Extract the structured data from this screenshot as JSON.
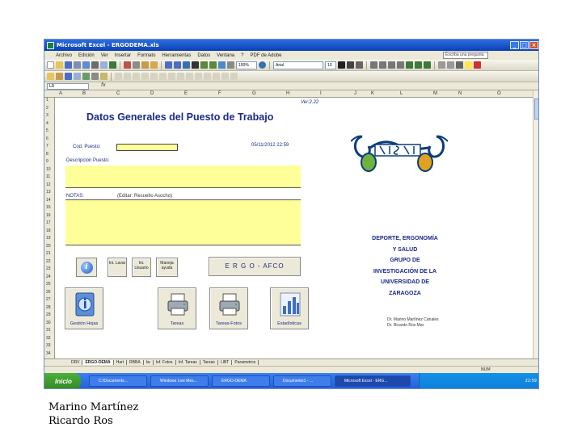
{
  "window": {
    "title": "Microsoft Excel - ERGODEMA.xls"
  },
  "menu": [
    "Archivo",
    "Edición",
    "Ver",
    "Insertar",
    "Formato",
    "Herramientas",
    "Datos",
    "Ventana",
    "?",
    "PDF de Adobe"
  ],
  "menu_help_placeholder": "Escriba una pregunta",
  "toolbar": {
    "zoom": "100%",
    "font": "Arial",
    "font_size": "10"
  },
  "formula_bar": {
    "name_box": "L9",
    "fx": "fx"
  },
  "columns": [
    "A",
    "B",
    "C",
    "D",
    "E",
    "F",
    "G",
    "H",
    "I",
    "J",
    "K",
    "L",
    "M",
    "N",
    "O"
  ],
  "rows": [
    "1",
    "2",
    "3",
    "4",
    "5",
    "6",
    "7",
    "8",
    "9",
    "10",
    "11",
    "12",
    "13",
    "14",
    "15",
    "16",
    "17",
    "18",
    "19",
    "20",
    "21",
    "22",
    "23",
    "24",
    "25",
    "26",
    "27",
    "28",
    "29",
    "30",
    "31",
    "32",
    "33",
    "34"
  ],
  "sheet": {
    "version": "Ver.2.22",
    "title": "Datos Generales del Puesto de Trabajo",
    "cod_label": "Cod. Puesto:",
    "date": "05/11/2012 22:59",
    "desc_label": "Descripcion Puesto:",
    "notes_label": "NOTAS:",
    "notes_text": "(Editar: Resuelto Asocho)",
    "buttons": {
      "btn1": "Ini. Lavar",
      "btn2": "Ini. Usuario",
      "btn3": "Maneja ayuda",
      "ergo": "E R G O - AFCO",
      "big1": "Gestión Hojas",
      "big2": "Tareas",
      "big3": "Tareas-Fotos",
      "big4": "Estadísticas"
    },
    "org_lines": [
      "DEPORTE, ERGONOMÍA",
      "Y SALUD",
      "GRUPO DE",
      "INVESTIGACIÓN DE LA",
      "UNIVERSIDAD DE",
      "ZARAGOZA"
    ],
    "authors": [
      "Dr. Marino Martínez Canales",
      "Dr. Ricardo Ros Mar"
    ]
  },
  "tabs": [
    "DRV",
    "ERGO-DEMA",
    "Hart",
    "RBBA",
    "Iw",
    "Inf. Fotos",
    "Inf. Tareas",
    "Tareas",
    "LIBT",
    "Parametros"
  ],
  "active_tab": "ERGO-DEMA",
  "status": {
    "num": "NUM"
  },
  "taskbar": {
    "start": "Inicio",
    "items": [
      "C:\\Documents...",
      "Windows Live Mes...",
      "ERGO-DEMA",
      "Documento1 - ...",
      "Microsoft Excel - ERG..."
    ],
    "clock": "22:59"
  },
  "caption": {
    "line1": "Marino Martínez",
    "line2": "Ricardo Ros"
  }
}
